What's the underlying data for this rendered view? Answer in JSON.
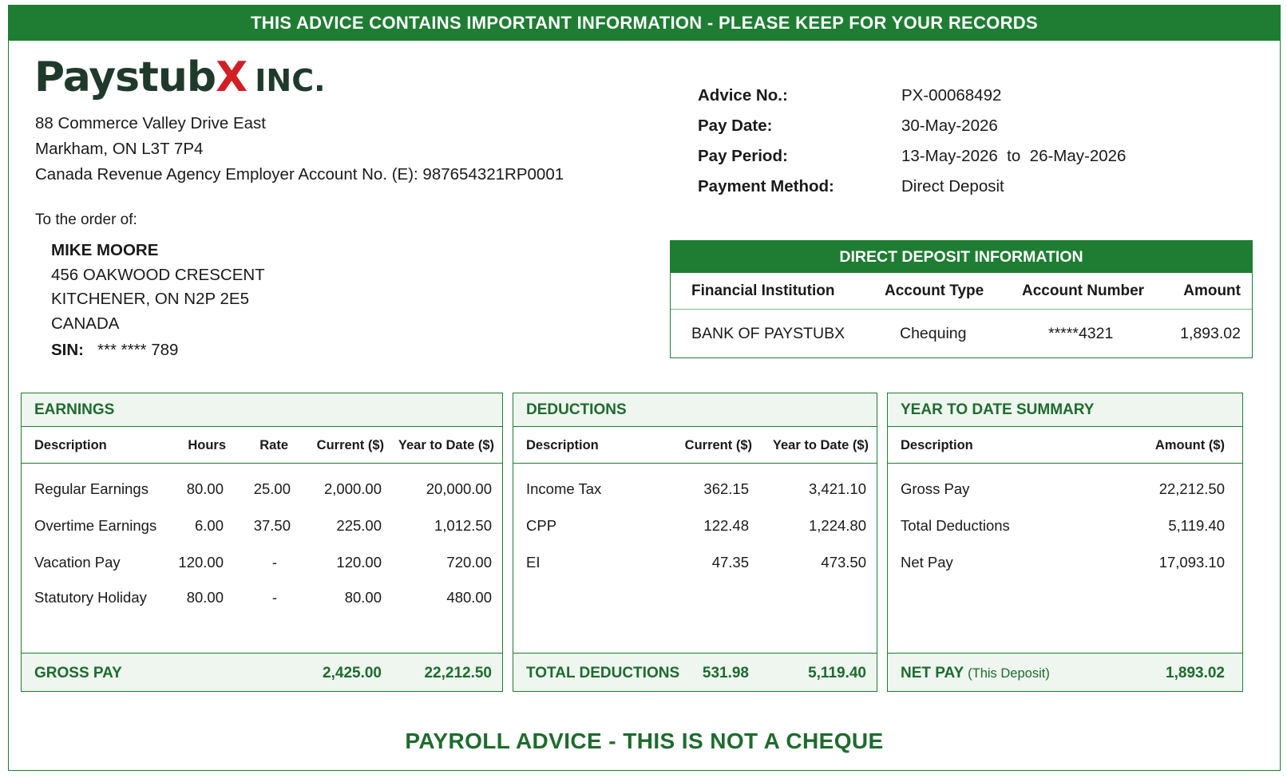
{
  "banner": "THIS ADVICE CONTAINS IMPORTANT INFORMATION - PLEASE KEEP FOR YOUR RECORDS",
  "company": {
    "logo_main": "Paystub",
    "logo_x": "X",
    "logo_suffix": "INC.",
    "address1": "88 Commerce Valley Drive East",
    "address2": "Markham, ON  L3T 7P4",
    "employer_account": "Canada Revenue Agency Employer Account No. (E): 987654321RP0001"
  },
  "advice": [
    {
      "label": "Advice No.:",
      "value": "PX-00068492"
    },
    {
      "label": "Pay Date:",
      "value": "30-May-2026"
    },
    {
      "label": "Pay Period:",
      "value": "13-May-2026  to  26-May-2026"
    },
    {
      "label": "Payment Method:",
      "value": "Direct Deposit"
    }
  ],
  "payee": {
    "order_label": "To the order of:",
    "name": "MIKE MOORE",
    "line1": "456 OAKWOOD CRESCENT",
    "line2": "KITCHENER, ON  N2P 2E5",
    "line3": "CANADA",
    "sin_label": "SIN:",
    "sin_value": "*** **** 789"
  },
  "direct_deposit": {
    "title": "DIRECT DEPOSIT INFORMATION",
    "headers": [
      "Financial Institution",
      "Account Type",
      "Account Number",
      "Amount"
    ],
    "row": [
      "BANK OF PAYSTUBX",
      "Chequing",
      "*****4321",
      "1,893.02"
    ]
  },
  "earnings": {
    "title": "EARNINGS",
    "headers": [
      "Description",
      "Hours",
      "Rate",
      "Current ($)",
      "Year to Date ($)"
    ],
    "rows": [
      [
        "Regular Earnings",
        "80.00",
        "25.00",
        "2,000.00",
        "20,000.00"
      ],
      [
        "Overtime Earnings",
        "6.00",
        "37.50",
        "225.00",
        "1,012.50"
      ],
      [
        "Vacation Pay",
        "120.00",
        "-",
        "120.00",
        "720.00"
      ],
      [
        "Statutory Holiday",
        "80.00",
        "-",
        "80.00",
        "480.00"
      ]
    ],
    "total_label": "GROSS PAY",
    "total_current": "2,425.00",
    "total_ytd": "22,212.50"
  },
  "deductions": {
    "title": "DEDUCTIONS",
    "headers": [
      "Description",
      "Current ($)",
      "Year to Date ($)"
    ],
    "rows": [
      [
        "Income Tax",
        "362.15",
        "3,421.10"
      ],
      [
        "CPP",
        "122.48",
        "1,224.80"
      ],
      [
        "EI",
        "47.35",
        "473.50"
      ]
    ],
    "total_label": "TOTAL DEDUCTIONS",
    "total_current": "531.98",
    "total_ytd": "5,119.40"
  },
  "ytd_summary": {
    "title": "YEAR TO DATE SUMMARY",
    "headers": [
      "Description",
      "Amount ($)"
    ],
    "rows": [
      [
        "Gross Pay",
        "22,212.50"
      ],
      [
        "Total Deductions",
        "5,119.40"
      ],
      [
        "Net Pay",
        "17,093.10"
      ]
    ],
    "total_label": "NET PAY",
    "total_note": "(This Deposit)",
    "total_amount": "1,893.02"
  },
  "footer": "PAYROLL ADVICE - THIS IS NOT A CHEQUE",
  "colors": {
    "brand_green": "#1e7d32",
    "logo_red": "#d21f26"
  }
}
